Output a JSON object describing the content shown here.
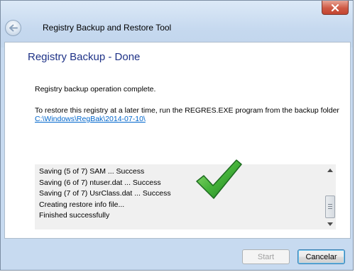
{
  "window": {
    "title": "Registry Backup and Restore Tool"
  },
  "page": {
    "heading": "Registry Backup - Done",
    "message_complete": "Registry backup operation complete.",
    "message_restore": "To restore this registry at a later time, run the REGRES.EXE program from the backup folder",
    "backup_folder": "C:\\Windows\\RegBak\\2014-07-10\\"
  },
  "log": {
    "lines": [
      "Saving (5 of 7) SAM ... Success",
      "Saving (6 of 7) ntuser.dat ... Success",
      "Saving (7 of 7) UsrClass.dat ... Success",
      "Creating restore info file...",
      "Finished successfully"
    ]
  },
  "buttons": {
    "start": "Start",
    "cancel": "Cancelar"
  },
  "icons": {
    "close": "close-icon",
    "back": "back-arrow-icon",
    "success": "checkmark-icon"
  },
  "colors": {
    "heading": "#1e3287",
    "link": "#0066cc",
    "checkmark": "#3aa83c",
    "close_button": "#c94b37"
  }
}
